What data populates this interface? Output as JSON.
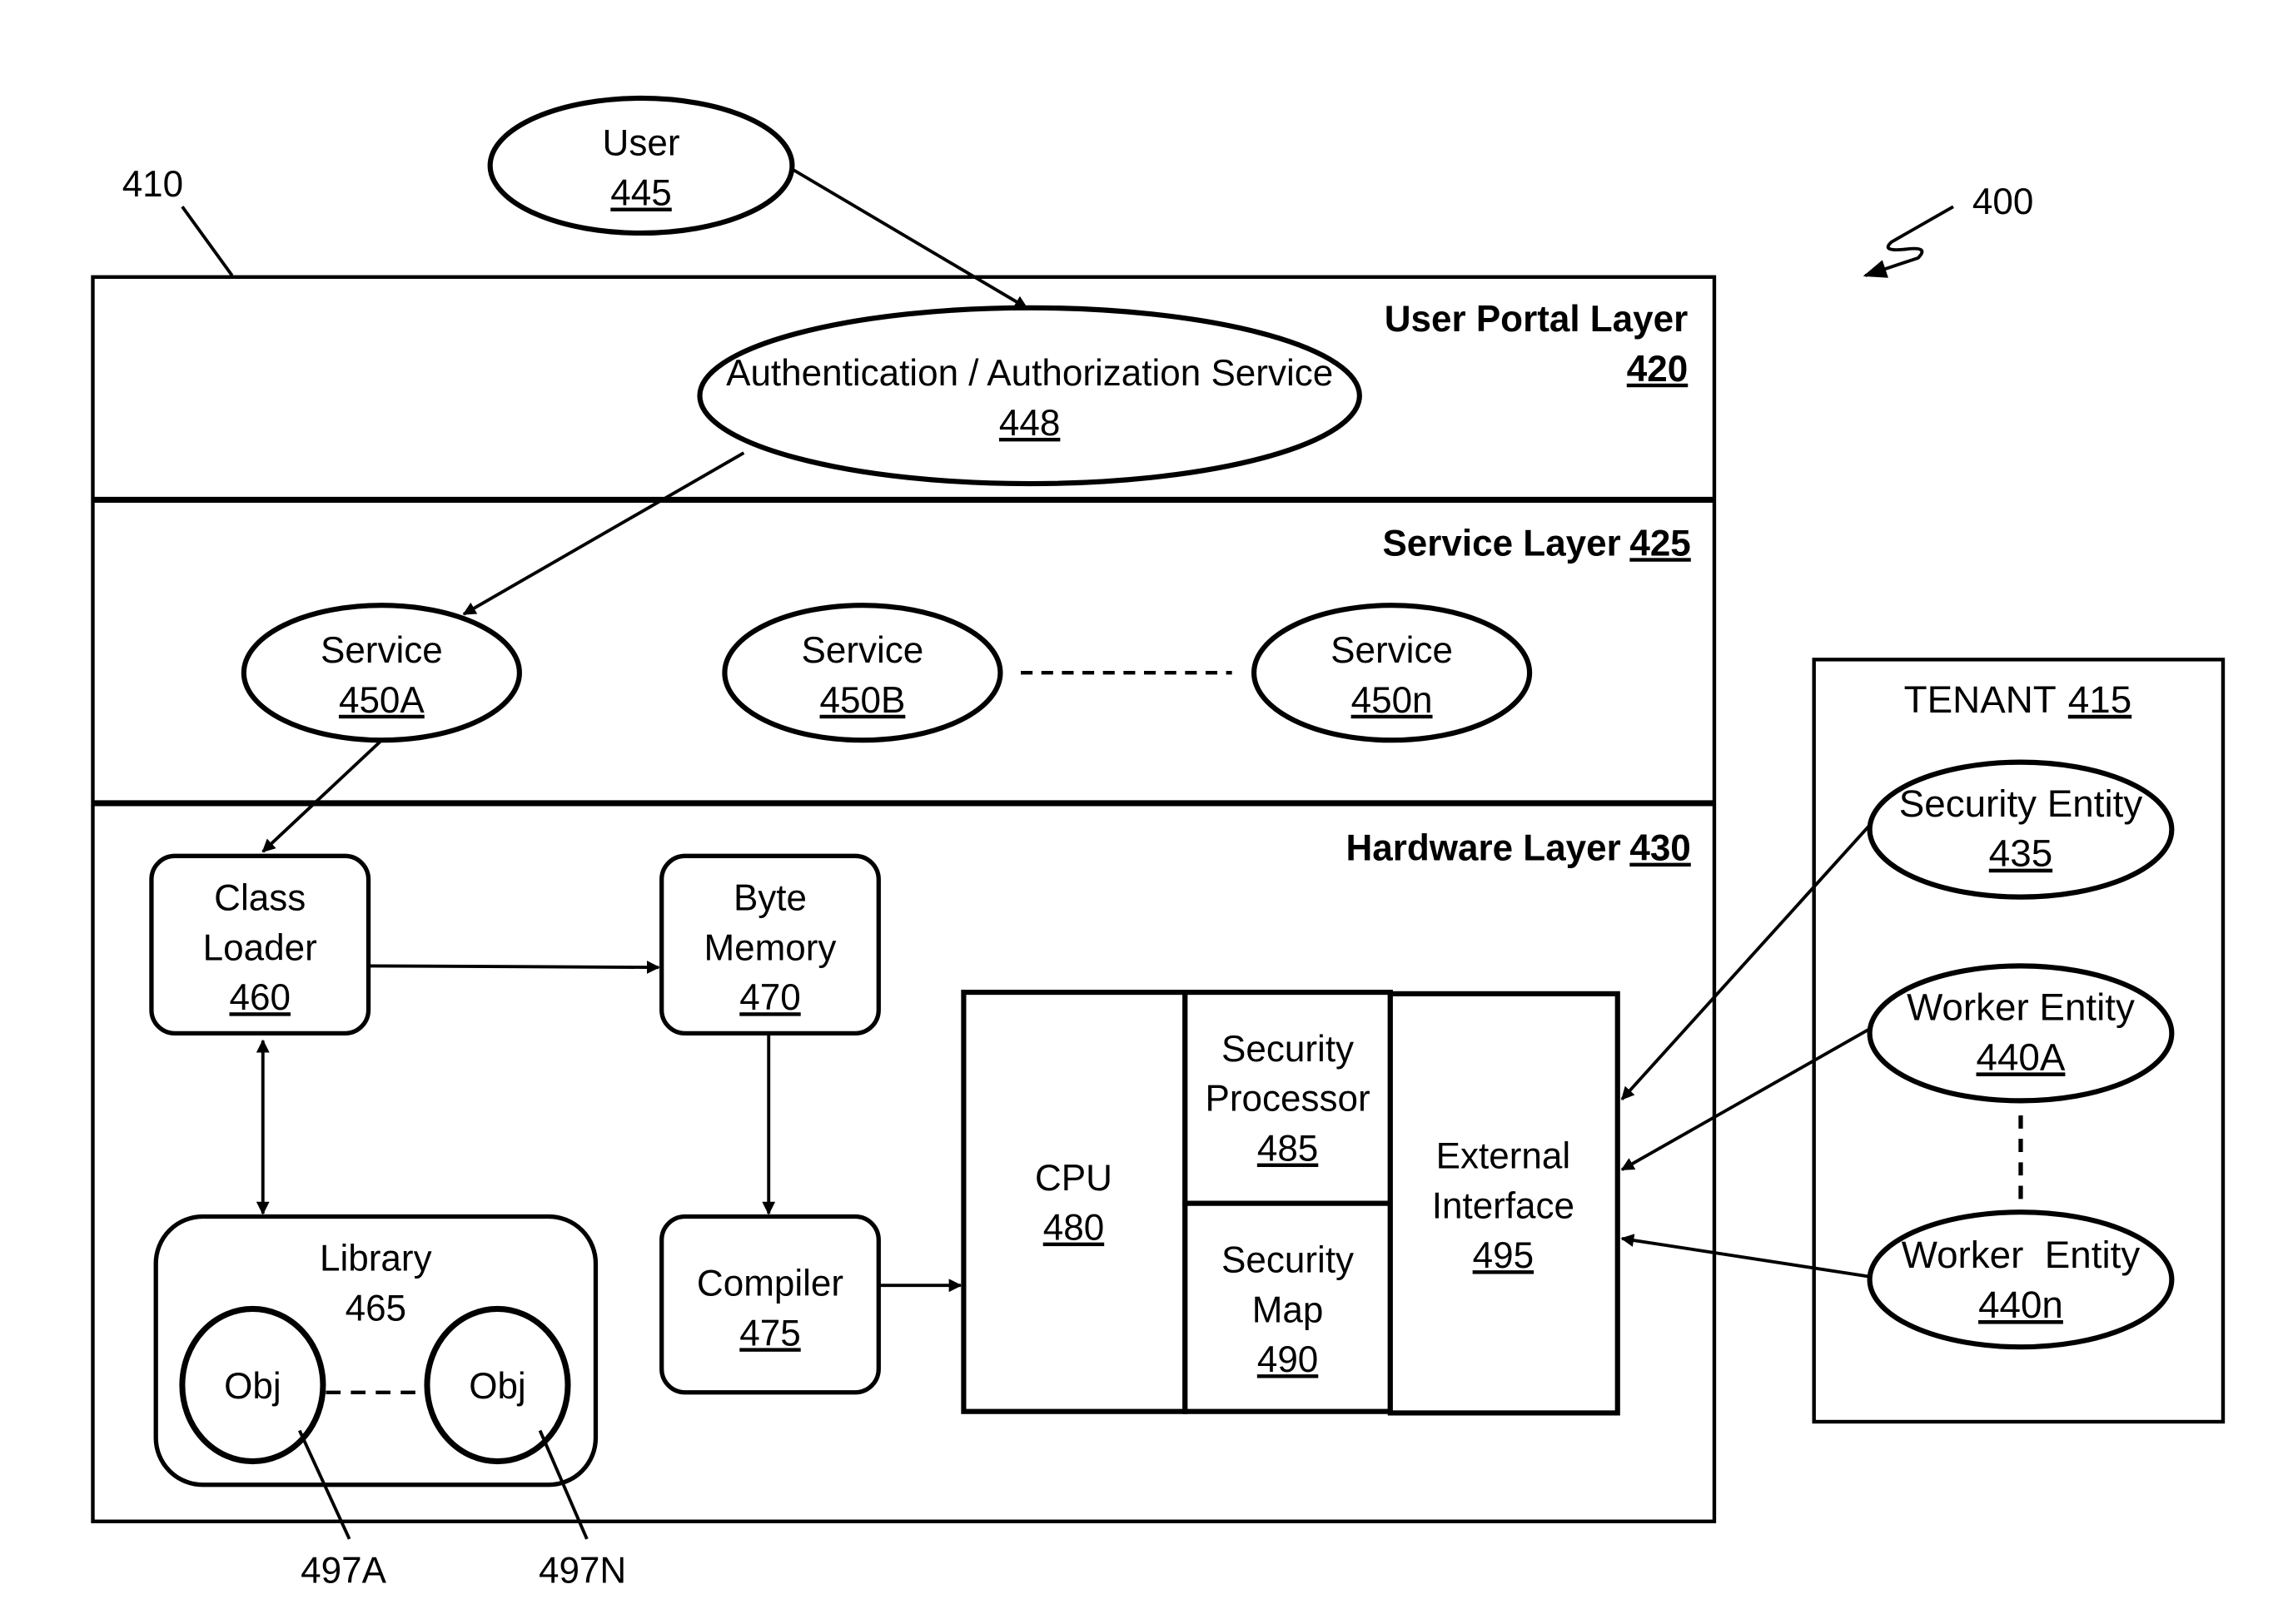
{
  "figure": {
    "ref": "400",
    "system_ref": "410"
  },
  "colors": {
    "ink": "#000000",
    "background": "#ffffff"
  },
  "user": {
    "label": "User",
    "ref": "445"
  },
  "layers": {
    "user_portal": {
      "label": "User Portal Layer",
      "ref": "420"
    },
    "service": {
      "label": "Service Layer",
      "ref": "425"
    },
    "hardware": {
      "label": "Hardware Layer",
      "ref": "430"
    }
  },
  "auth": {
    "label": "Authentication / Authorization Service",
    "ref": "448"
  },
  "services": [
    {
      "label": "Service",
      "ref": "450A"
    },
    {
      "label": "Service",
      "ref": "450B"
    },
    {
      "label": "Service",
      "ref": "450n"
    }
  ],
  "hardware": {
    "class_loader": {
      "line1": "Class",
      "line2": "Loader",
      "ref": "460"
    },
    "byte_memory": {
      "line1": "Byte",
      "line2": "Memory",
      "ref": "470"
    },
    "library": {
      "label": "Library",
      "ref": "465",
      "obj_a": "Obj",
      "obj_n": "Obj",
      "obj_a_ref": "497A",
      "obj_n_ref": "497N"
    },
    "compiler": {
      "label": "Compiler",
      "ref": "475"
    },
    "cpu": {
      "label": "CPU",
      "ref": "480"
    },
    "security_processor": {
      "line1": "Security",
      "line2": "Processor",
      "ref": "485"
    },
    "security_map": {
      "line1": "Security",
      "line2": "Map",
      "ref": "490"
    },
    "external_interface": {
      "line1": "External",
      "line2": "Interface",
      "ref": "495"
    }
  },
  "tenant": {
    "label": "TENANT",
    "ref": "415",
    "entities": [
      {
        "label": "Security Entity",
        "ref": "435"
      },
      {
        "label": "Worker Entity",
        "ref": "440A"
      },
      {
        "label": "Worker  Entity",
        "ref": "440n"
      }
    ]
  }
}
